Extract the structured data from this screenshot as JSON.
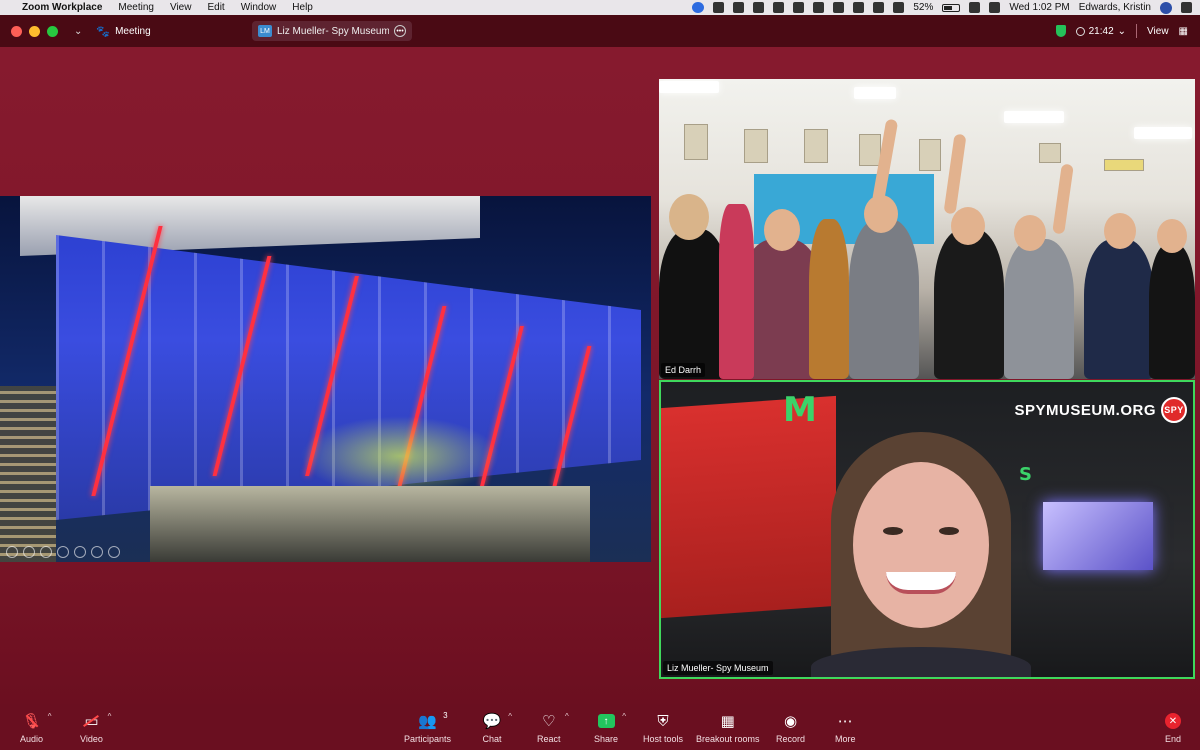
{
  "menubar": {
    "app_name": "Zoom Workplace",
    "menus": [
      "Meeting",
      "View",
      "Edit",
      "Window",
      "Help"
    ],
    "battery": "52%",
    "datetime": "Wed 1:02 PM",
    "user": "Edwards, Kristin"
  },
  "titlebar": {
    "label": "Meeting",
    "share_initials": "LM",
    "share_title": "Liz Mueller- Spy Museum's screen",
    "timer": "21:42",
    "view_label": "View"
  },
  "tiles": [
    {
      "name": "Ed Darrh"
    },
    {
      "name": "Liz Mueller- Spy Museum"
    }
  ],
  "spy_logo": {
    "text": "SPYMUSEUM.ORG",
    "badge": "SPY"
  },
  "spy_letters": [
    "M",
    "S"
  ],
  "toolbar": {
    "audio": "Audio",
    "video": "Video",
    "participants": "Participants",
    "participant_count": "3",
    "chat": "Chat",
    "react": "React",
    "share": "Share",
    "host_tools": "Host tools",
    "breakout_rooms": "Breakout rooms",
    "record": "Record",
    "more": "More",
    "end": "End"
  },
  "colors": {
    "background": "#7a1428",
    "toolbar": "#6a0f20",
    "active_speaker_border": "#3fd85c",
    "share_button": "#22c55e",
    "end_button": "#e8232e"
  }
}
